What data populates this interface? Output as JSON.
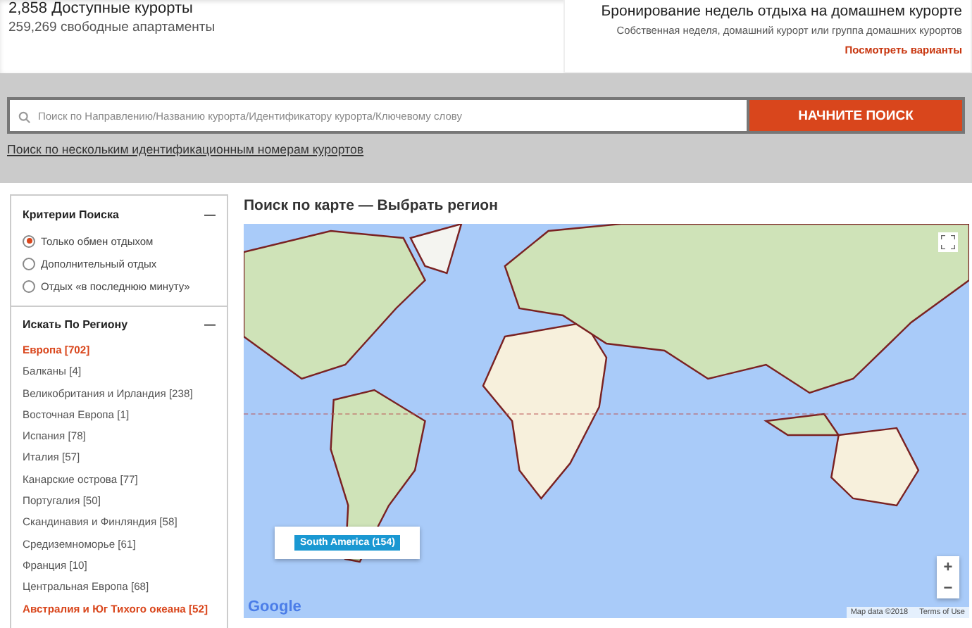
{
  "stats": {
    "resorts": "2,858 Доступные курорты",
    "apartments": "259,269 свободные апартаменты"
  },
  "home_week": {
    "title": "Бронирование недель отдыха на домашнем курорте",
    "subtitle": "Собственная неделя, домашний курорт или группа домашних курортов",
    "link": "Посмотреть варианты"
  },
  "search": {
    "placeholder": "Поиск по Направлению/Названию курорта/Идентификатору курорта/Ключевому слову",
    "button": "НАЧНИТЕ ПОИСК",
    "multi_link": "Поиск по нескольким идентификационным номерам курортов"
  },
  "criteria": {
    "title": "Критерии Поиска",
    "collapse": "—",
    "options": [
      {
        "label": "Только обмен отдыхом",
        "selected": true
      },
      {
        "label": "Дополнительный отдых",
        "selected": false
      },
      {
        "label": "Отдых «в последнюю минуту»",
        "selected": false
      }
    ]
  },
  "regions": {
    "title": "Искать По Региону",
    "collapse": "—",
    "items": [
      {
        "label": "Европа [702]",
        "selected": true
      },
      {
        "label": "Балканы [4]",
        "selected": false
      },
      {
        "label": "Великобритания и Ирландия [238]",
        "selected": false
      },
      {
        "label": "Восточная Европа [1]",
        "selected": false
      },
      {
        "label": "Испания [78]",
        "selected": false
      },
      {
        "label": "Италия [57]",
        "selected": false
      },
      {
        "label": "Канарские острова [77]",
        "selected": false
      },
      {
        "label": "Португалия [50]",
        "selected": false
      },
      {
        "label": "Скандинавия и Финляндия [58]",
        "selected": false
      },
      {
        "label": "Средиземноморье [61]",
        "selected": false
      },
      {
        "label": "Франция [10]",
        "selected": false
      },
      {
        "label": "Центральная Европа [68]",
        "selected": false
      },
      {
        "label": "Австралия и Юг Тихого океана [52]",
        "selected": true
      }
    ]
  },
  "map": {
    "title": "Поиск по карте — Выбрать регион",
    "tooltip": "South America (154)",
    "zoom_in": "+",
    "zoom_out": "−",
    "logo": "Google",
    "attribution": "Map data ©2018",
    "terms": "Terms of Use"
  }
}
